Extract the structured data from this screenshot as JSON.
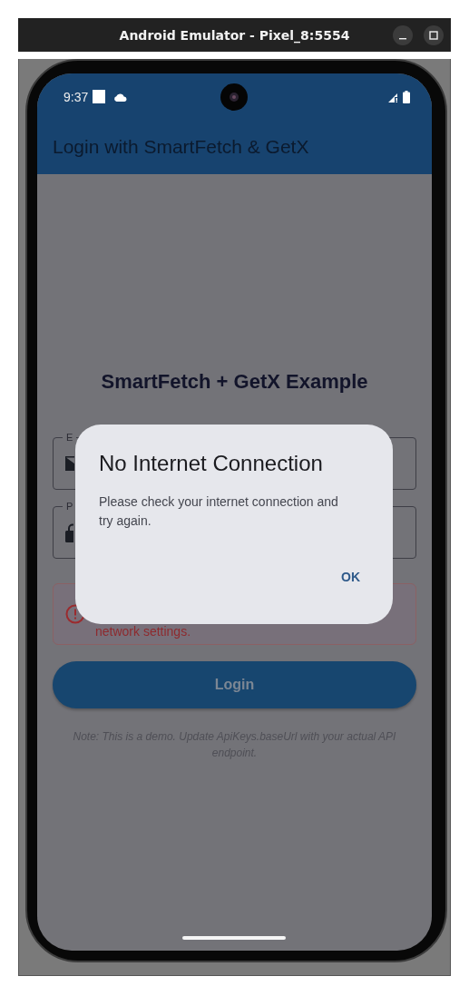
{
  "window": {
    "title": "Android Emulator - Pixel_8:5554"
  },
  "status_bar": {
    "time": "9:37"
  },
  "app_bar": {
    "title": "Login with SmartFetch & GetX"
  },
  "heading": "SmartFetch + GetX Example",
  "fields": [
    {
      "kind": "email",
      "label": "E"
    },
    {
      "kind": "password",
      "label": "P"
    }
  ],
  "error_banner": {
    "text": "network settings."
  },
  "login_button": {
    "label": "Login"
  },
  "note": "Note: This is a demo. Update ApiKeys.baseUrl with your actual API endpoint.",
  "dialog": {
    "title": "No Internet Connection",
    "message": "Please check your internet connection and try again.",
    "actions": [
      "OK"
    ]
  }
}
